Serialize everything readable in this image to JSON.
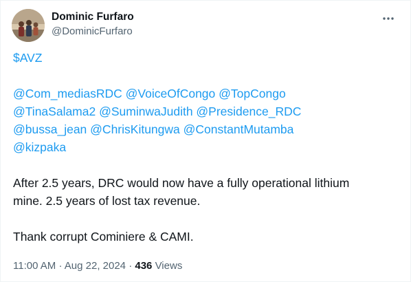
{
  "author": {
    "display_name": "Dominic Furfaro",
    "handle": "@DominicFurfaro"
  },
  "menu_icon": "more-horizontal-icon",
  "tweet": {
    "cashtag": "$AVZ",
    "mentions_lines": [
      [
        "@Com_mediasRDC",
        "@VoiceOfCongo",
        "@TopCongo"
      ],
      [
        "@TinaSalama2",
        "@SuminwaJudith",
        "@Presidence_RDC"
      ],
      [
        "@bussa_jean",
        "@ChrisKitungwa",
        "@ConstantMutamba"
      ],
      [
        "@kizpaka"
      ]
    ],
    "body_line1": "After 2.5 years, DRC would now have a fully operational lithium",
    "body_line2": "mine. 2.5 years of lost tax revenue.",
    "body_line3": "Thank corrupt Cominiere & CAMI."
  },
  "meta": {
    "time": "11:00 AM",
    "separator": "·",
    "date": "Aug 22, 2024",
    "views_count": "436",
    "views_label": "Views"
  },
  "colors": {
    "link": "#1d9bf0",
    "text": "#0f1419",
    "secondary": "#536471"
  }
}
